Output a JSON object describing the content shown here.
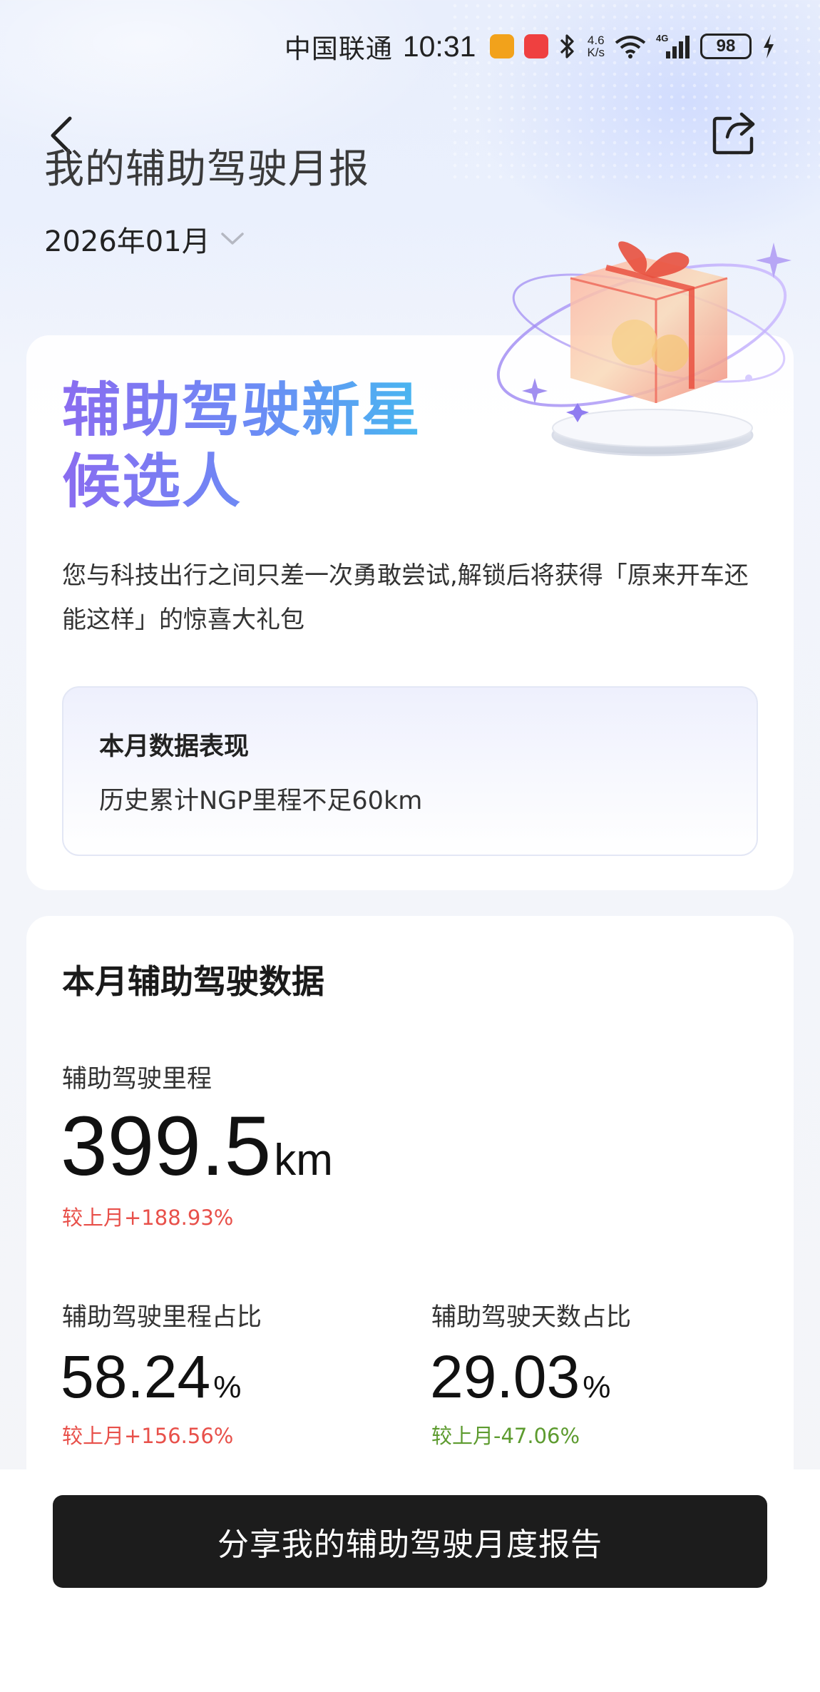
{
  "status_bar": {
    "carrier": "中国联通",
    "time": "10:31",
    "net_speed_value": "4.6",
    "net_speed_unit": "K/s",
    "network": "4G",
    "battery": "98"
  },
  "header": {
    "title": "我的辅助驾驶月报",
    "month": "2026年01月"
  },
  "badge_card": {
    "title_line1": "辅助驾驶新星",
    "title_line2": "候选人",
    "description": "您与科技出行之间只差一次勇敢尝试,解锁后将获得「原来开车还能这样」的惊喜大礼包",
    "performance": {
      "title": "本月数据表现",
      "value": "历史累计NGP里程不足60km"
    }
  },
  "stats_card": {
    "title": "本月辅助驾驶数据",
    "mileage": {
      "label": "辅助驾驶里程",
      "value": "399.5",
      "unit": "km",
      "change": "较上月+188.93%"
    },
    "mileage_ratio": {
      "label": "辅助驾驶里程占比",
      "value": "58.24",
      "unit": "%",
      "change": "较上月+156.56%"
    },
    "days_ratio": {
      "label": "辅助驾驶天数占比",
      "value": "29.03",
      "unit": "%",
      "change": "较上月-47.06%"
    }
  },
  "bottom": {
    "share_button": "分享我的辅助驾驶月度报告"
  },
  "colors": {
    "accent_gradient_start": "#8a6cf0",
    "accent_gradient_end": "#48b7f0",
    "increase": "#e8504a",
    "decrease": "#5d9b2f",
    "button_bg": "#1c1c1c"
  },
  "icons": [
    "back-icon",
    "share-icon",
    "chevron-down-icon",
    "bluetooth-icon",
    "wifi-icon",
    "signal-icon",
    "charging-icon",
    "gift-illustration"
  ]
}
